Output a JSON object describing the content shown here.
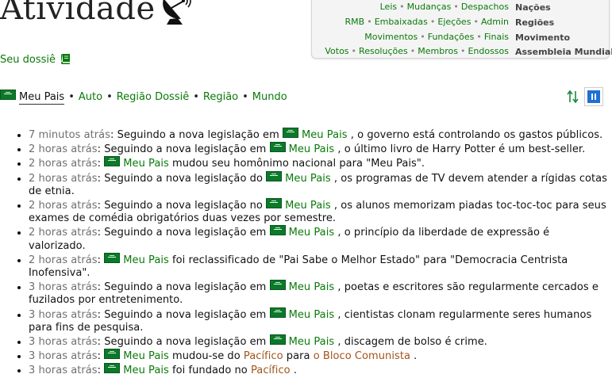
{
  "header": {
    "title": "Atividade",
    "dossier_link": "Seu dossiê"
  },
  "nav": {
    "rows": [
      {
        "links": [
          "Leis",
          "Mudanças",
          "Despachos"
        ],
        "label": "Nações"
      },
      {
        "links": [
          "RMB",
          "Embaixadas",
          "Ejeções",
          "Admin"
        ],
        "label": "Regiões"
      },
      {
        "links": [
          "Movimentos",
          "Fundações",
          "Finais"
        ],
        "label": "Movimento"
      },
      {
        "links": [
          "Votos",
          "Resoluções",
          "Membros",
          "Endossos"
        ],
        "label": "Assembleia Mundial"
      }
    ]
  },
  "filters": {
    "items": [
      "Meu Pais",
      "Auto",
      "Região Dossiê",
      "Região",
      "Mundo"
    ],
    "active": "Meu Pais"
  },
  "icons": {
    "title_icon": "satellite-dish-icon",
    "dossier_icon": "book-icon",
    "flag_icon": "nation-flag-icon",
    "sort_icon": "sort-arrows-icon",
    "pause_icon": "pause-icon"
  },
  "colors": {
    "link": "#0a7a0a",
    "timestamp": "#6f6f6f",
    "region_link": "#a2541a",
    "pause_button": "#1e6fd6"
  },
  "feed": [
    {
      "time": "7 minutos atrás",
      "pre": "Seguindo a nova legislação em",
      "nation": "Meu Pais",
      "post": ", o governo está controlando os gastos públicos."
    },
    {
      "time": "2 horas atrás",
      "pre": "Seguindo a nova legislação em",
      "nation": "Meu Pais",
      "post": ", o último livro de Harry Potter é um best-seller."
    },
    {
      "time": "2 horas atrás",
      "pre": "",
      "nation": "Meu Pais",
      "post": "mudou seu homônimo nacional para \"Meu Pais\"."
    },
    {
      "time": "2 horas atrás",
      "pre": "Seguindo a nova legislação do",
      "nation": "Meu Pais",
      "post": ", os programas de TV devem atender a rígidas cotas de etnia."
    },
    {
      "time": "2 horas atrás",
      "pre": "Seguindo a nova legislação no",
      "nation": "Meu Pais",
      "post": ", os alunos memorizam piadas toc-toc-toc para seus exames de comédia obrigatórios duas vezes por semestre."
    },
    {
      "time": "2 horas atrás",
      "pre": "Seguindo a nova legislação em",
      "nation": "Meu Pais",
      "post": ", o princípio da liberdade de expressão é valorizado."
    },
    {
      "time": "2 horas atrás",
      "pre": "",
      "nation": "Meu Pais",
      "post": "foi reclassificado de \"Pai Sabe o Melhor Estado\" para \"Democracia Centrista Inofensiva\"."
    },
    {
      "time": "3 horas atrás",
      "pre": "Seguindo a nova legislação em",
      "nation": "Meu Pais",
      "post": ", poetas e escritores são regularmente cercados e fuzilados por entretenimento."
    },
    {
      "time": "3 horas atrás",
      "pre": "Seguindo a nova legislação em",
      "nation": "Meu Pais",
      "post": ", cientistas clonam regularmente seres humanos para fins de pesquisa."
    },
    {
      "time": "3 horas atrás",
      "pre": "Seguindo a nova legislação em",
      "nation": "Meu Pais",
      "post": ", discagem de bolso é crime."
    },
    {
      "time": "3 horas atrás",
      "pre": "",
      "nation": "Meu Pais",
      "post": "mudou-se do",
      "region1": "Pacífico",
      "mid": "para",
      "region2": "o Bloco Comunista",
      "end": "."
    },
    {
      "time": "3 horas atrás",
      "pre": "",
      "nation": "Meu Pais",
      "post": "foi fundado no",
      "region1": "Pacífico",
      "end": "."
    }
  ]
}
